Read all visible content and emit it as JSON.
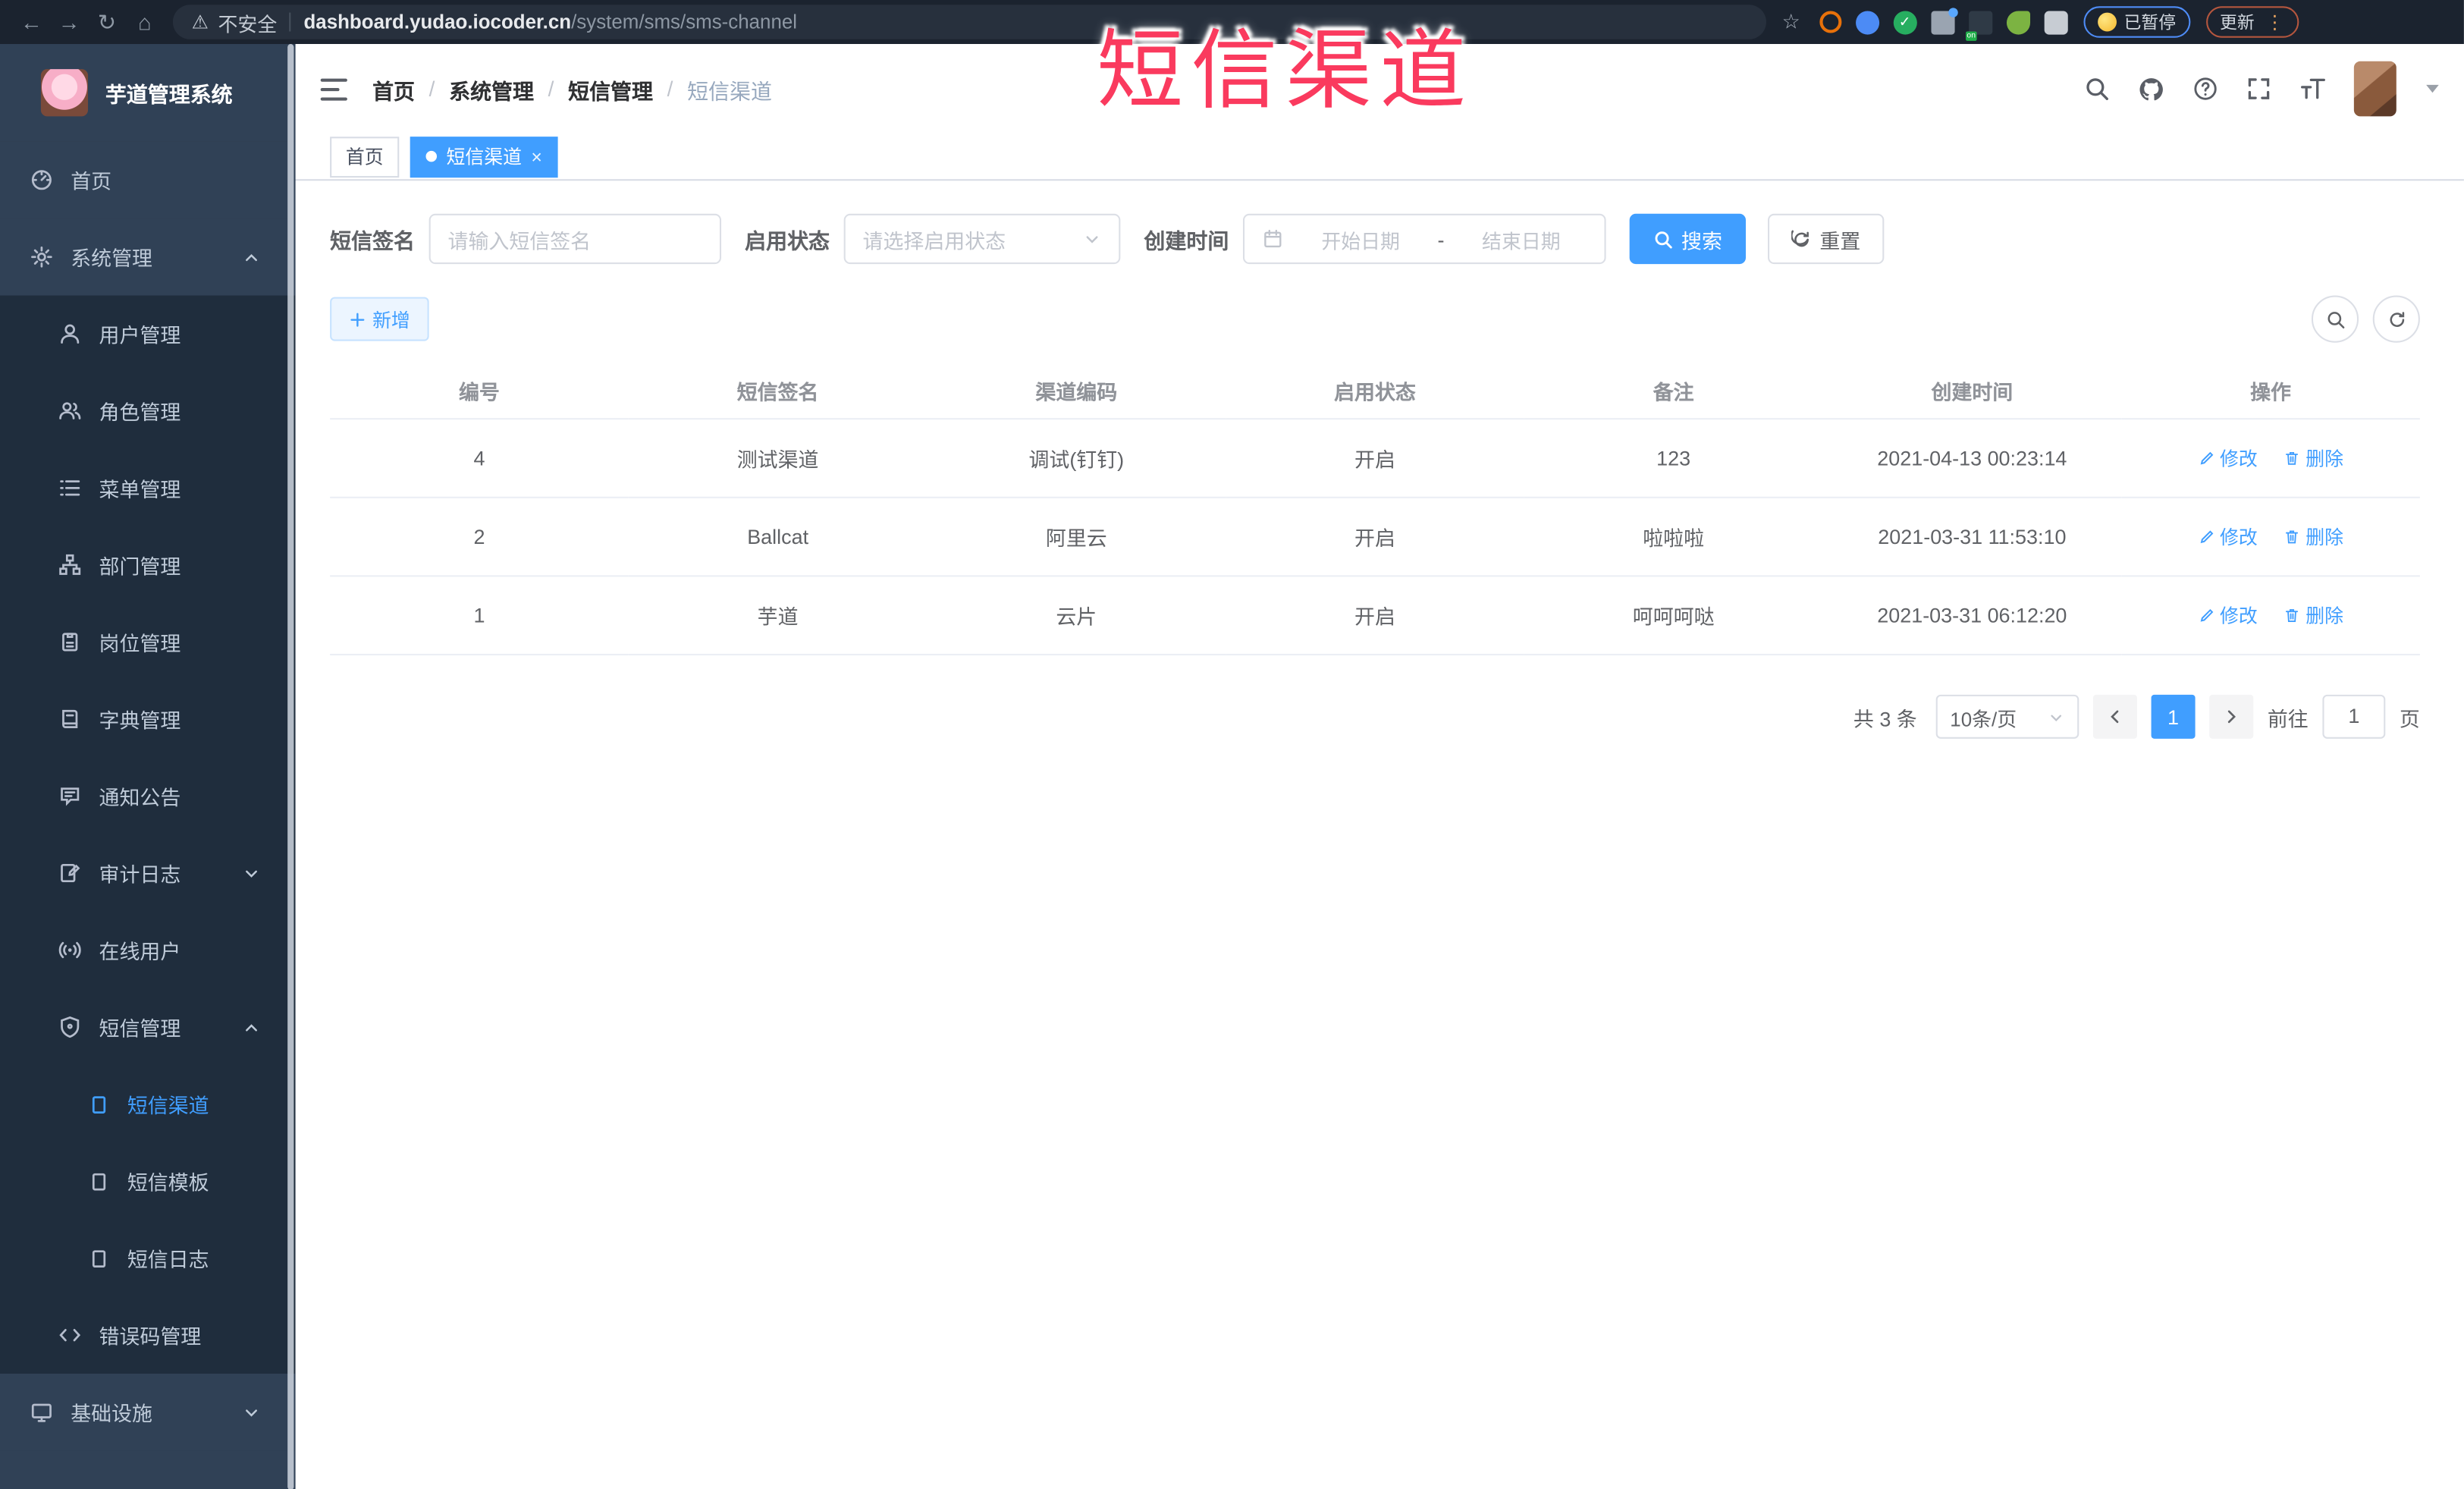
{
  "browser": {
    "security_label": "不安全",
    "url_host": "dashboard.yudao.iocoder.cn",
    "url_path": "/system/sms/sms-channel",
    "extension_badge": "on",
    "paused_badge": "已暂停",
    "update_button": "更新"
  },
  "icons": {
    "back": "←",
    "forward": "→",
    "reload": "↻",
    "home": "⌂",
    "warning": "⚠",
    "star": "☆",
    "menu_dots": "⋮",
    "close": "×"
  },
  "annotation": {
    "text": "短信渠道",
    "color": "#fa3a5e"
  },
  "sidebar": {
    "app_title": "芋道管理系统",
    "items": [
      {
        "label": "首页",
        "icon": "dashboard-icon"
      },
      {
        "label": "系统管理",
        "icon": "gear-icon",
        "chevron": "up"
      },
      {
        "label": "用户管理",
        "icon": "user-icon"
      },
      {
        "label": "角色管理",
        "icon": "users-icon"
      },
      {
        "label": "菜单管理",
        "icon": "menu-list-icon"
      },
      {
        "label": "部门管理",
        "icon": "org-tree-icon"
      },
      {
        "label": "岗位管理",
        "icon": "badge-icon"
      },
      {
        "label": "字典管理",
        "icon": "dictionary-icon"
      },
      {
        "label": "通知公告",
        "icon": "announcement-icon"
      },
      {
        "label": "审计日志",
        "icon": "audit-log-icon",
        "chevron": "down"
      },
      {
        "label": "在线用户",
        "icon": "online-users-icon"
      },
      {
        "label": "短信管理",
        "icon": "sms-shield-icon",
        "chevron": "up"
      },
      {
        "label": "短信渠道",
        "icon": "document-icon",
        "active": true
      },
      {
        "label": "短信模板",
        "icon": "document-icon"
      },
      {
        "label": "短信日志",
        "icon": "document-icon"
      },
      {
        "label": "错误码管理",
        "icon": "code-icon"
      },
      {
        "label": "基础设施",
        "icon": "monitor-icon",
        "chevron": "down"
      }
    ]
  },
  "header": {
    "breadcrumb": [
      "首页",
      "系统管理",
      "短信管理",
      "短信渠道"
    ],
    "breadcrumb_separator": "/"
  },
  "tabs": [
    {
      "label": "首页"
    },
    {
      "label": "短信渠道",
      "active": true
    }
  ],
  "filters": {
    "sign_label": "短信签名",
    "sign_placeholder": "请输入短信签名",
    "status_label": "启用状态",
    "status_placeholder": "请选择启用状态",
    "time_label": "创建时间",
    "date_start_placeholder": "开始日期",
    "date_separator": "-",
    "date_end_placeholder": "结束日期",
    "search_button": "搜索",
    "reset_button": "重置"
  },
  "toolbar": {
    "add_button": "新增"
  },
  "table": {
    "headers": [
      "编号",
      "短信签名",
      "渠道编码",
      "启用状态",
      "备注",
      "创建时间",
      "操作"
    ],
    "rows": [
      {
        "id": "4",
        "sign": "测试渠道",
        "code": "调试(钉钉)",
        "status": "开启",
        "remark": "123",
        "created": "2021-04-13 00:23:14"
      },
      {
        "id": "2",
        "sign": "Ballcat",
        "code": "阿里云",
        "status": "开启",
        "remark": "啦啦啦",
        "created": "2021-03-31 11:53:10"
      },
      {
        "id": "1",
        "sign": "芋道",
        "code": "云片",
        "status": "开启",
        "remark": "呵呵呵哒",
        "created": "2021-03-31 06:12:20"
      }
    ],
    "action_edit": "修改",
    "action_delete": "删除"
  },
  "pagination": {
    "total": "共 3 条",
    "page_size": "10条/页",
    "current_page": "1",
    "goto_label": "前往",
    "goto_value": "1",
    "page_unit": "页"
  },
  "colors": {
    "accent": "#409eff",
    "sidebar_bg": "#304156",
    "submenu_bg": "#1f2d3d",
    "annotation": "#fa3a5e"
  }
}
